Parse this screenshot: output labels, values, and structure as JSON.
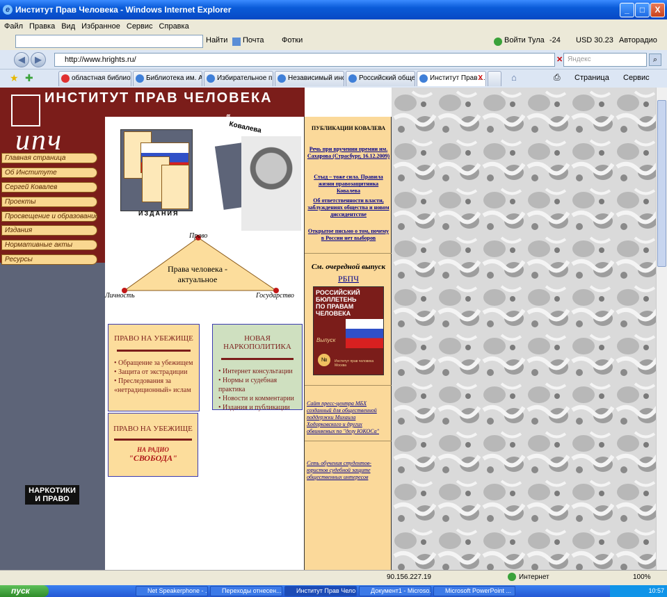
{
  "window": {
    "title": "Институт Прав Человека - Windows Internet Explorer",
    "min": "_",
    "max": "□",
    "close": "X"
  },
  "menu": [
    "Файл",
    "Правка",
    "Вид",
    "Избранное",
    "Сервис",
    "Справка"
  ],
  "toolbar": {
    "find": "Найти",
    "mail": "Почта",
    "photo": "Фотки",
    "login": "Войти Тула",
    "temp": "-24",
    "usd": "USD 30.23",
    "autoradio": "Авторадио"
  },
  "address": {
    "url": "http://www.hrights.ru/",
    "search_placeholder": "Яндекс"
  },
  "tabs": [
    "областная библиот...",
    "Библиотека им. А. ...",
    "Избирательное пр...",
    "Независимый инст...",
    "Российский общест...",
    "Институт Прав ..."
  ],
  "tab_close": "X",
  "page_tools": {
    "page": "Страница",
    "service": "Сервис"
  },
  "site": {
    "title": "ИНСТИТУТ ПРАВ ЧЕЛОВЕКА",
    "logo_text": "ипч",
    "nav": [
      "Главная страница",
      "Об Институте",
      "Сергей Ковалев",
      "Проекты",
      "Просвещение и образование",
      "Издания",
      "Нормативные акты",
      "Ресурсы"
    ],
    "izdaniya": "ИЗДАНИЯ",
    "kovaleva_label": "Ковалева",
    "stranitsa_label": "Страница",
    "triangle": {
      "top": "Право",
      "center": "Права человека - актуальное",
      "left": "Личность",
      "right": "Государство"
    },
    "narkotiki": "НАРКОТИКИ И ПРАВО",
    "box1": {
      "title": "ПРАВО НА УБЕЖИЩЕ",
      "items": [
        "• Обращение за убежищем",
        "• Защита от экстрадиции",
        "• Преследования за «нетрадиционный» ислам"
      ]
    },
    "box2": {
      "title": "НОВАЯ НАРКОПОЛИТИКА",
      "items": [
        "• Интернет консультации",
        "• Нормы и судебная практика",
        "• Новости и комментарии",
        "• Издания и публикации"
      ]
    },
    "box3": {
      "title": "ПРАВО НА УБЕЖИЩЕ",
      "sub1": "НА РАДИО",
      "sub2": "\"СВОБОДА\""
    },
    "publications": {
      "heading": "ПУБЛИКАЦИИ КОВАЛЕВА",
      "links": [
        "Речь при вручении премии им. Сахарова (Страсбург, 16.12.2009)",
        "Стыд – тоже сила. Правила жизни правозащитника Ковалева",
        "Об ответственности власти, заблуждениях общества и новом диссидентстве",
        "Открытое письмо о том, почему в России нет выборов"
      ]
    },
    "issue": {
      "label": "См. очередной выпуск",
      "link": "РБПЧ",
      "cover": "РОССИЙСКИЙ БЮЛЛЕТЕНЬ ПО ПРАВАМ ЧЕЛОВЕКА",
      "vypusk": "Выпуск",
      "num": "№",
      "publisher": "Институт прав человека Москва"
    },
    "side_links": [
      "Сайт пресс-центра МБХ созданный для общественной поддержки Михаила Ходорковского и других обвиняемых по \"делу ЮКОСа\"",
      "Сеть обучения студентов-юристов судебной защите общественных интересов"
    ]
  },
  "status": {
    "ip": "90.156.227.19",
    "zone": "Интернет",
    "zoom": "100%"
  },
  "taskbar": {
    "start": "пуск",
    "buttons": [
      "Net Speakerphone - ...",
      "Переходы отнесен...",
      "Институт Прав Чело...",
      "Документ1 - Microso...",
      "Microsoft PowerPoint ..."
    ],
    "clock": "10:57"
  },
  "colors": {
    "site_maroon": "#7b1d1a",
    "nav_yellow": "#f9d790",
    "right_pane": "#fbd99a",
    "link_blue": "#00008b"
  }
}
